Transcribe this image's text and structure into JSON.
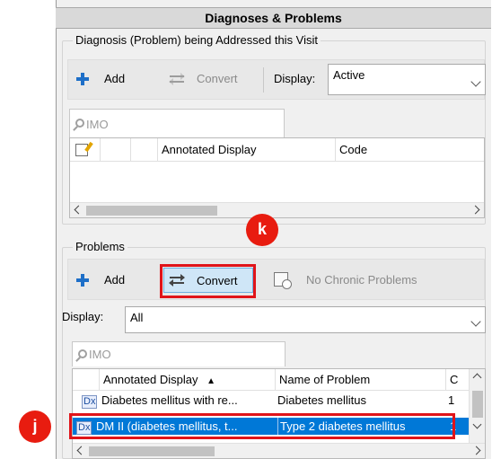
{
  "window": {
    "title": "Diagnoses & Problems"
  },
  "diagnosis_section": {
    "legend": "Diagnosis (Problem) being Addressed this Visit",
    "add_label": "Add",
    "convert_label": "Convert",
    "display_label": "Display:",
    "display_value": "Active",
    "search_placeholder": "IMO",
    "columns": [
      "Annotated Display",
      "Code"
    ]
  },
  "problems_section": {
    "legend": "Problems",
    "add_label": "Add",
    "convert_label": "Convert",
    "no_chronic_label": "No Chronic Problems",
    "display_label": "Display:",
    "display_value": "All",
    "search_placeholder": "IMO",
    "columns": [
      "Annotated Display",
      "Name of Problem",
      "C"
    ],
    "sort_indicator": "▲",
    "rows": [
      {
        "badge": "Dx",
        "annotated": "Diabetes mellitus with re...",
        "name": "Diabetes mellitus",
        "c": "1"
      },
      {
        "badge": "Dx",
        "annotated": "DM II (diabetes mellitus, t...",
        "name": "Type 2 diabetes mellitus",
        "c": "1"
      }
    ]
  },
  "callouts": {
    "k": "k",
    "j": "j"
  },
  "colors": {
    "selection": "#0078d7",
    "callout": "#e81c10",
    "accent": "#1e6fc8"
  },
  "icons": [
    "plus-icon",
    "convert-icon",
    "chevron-down-icon",
    "search-icon",
    "note-icon",
    "chronic-problems-icon",
    "dx-icon"
  ]
}
